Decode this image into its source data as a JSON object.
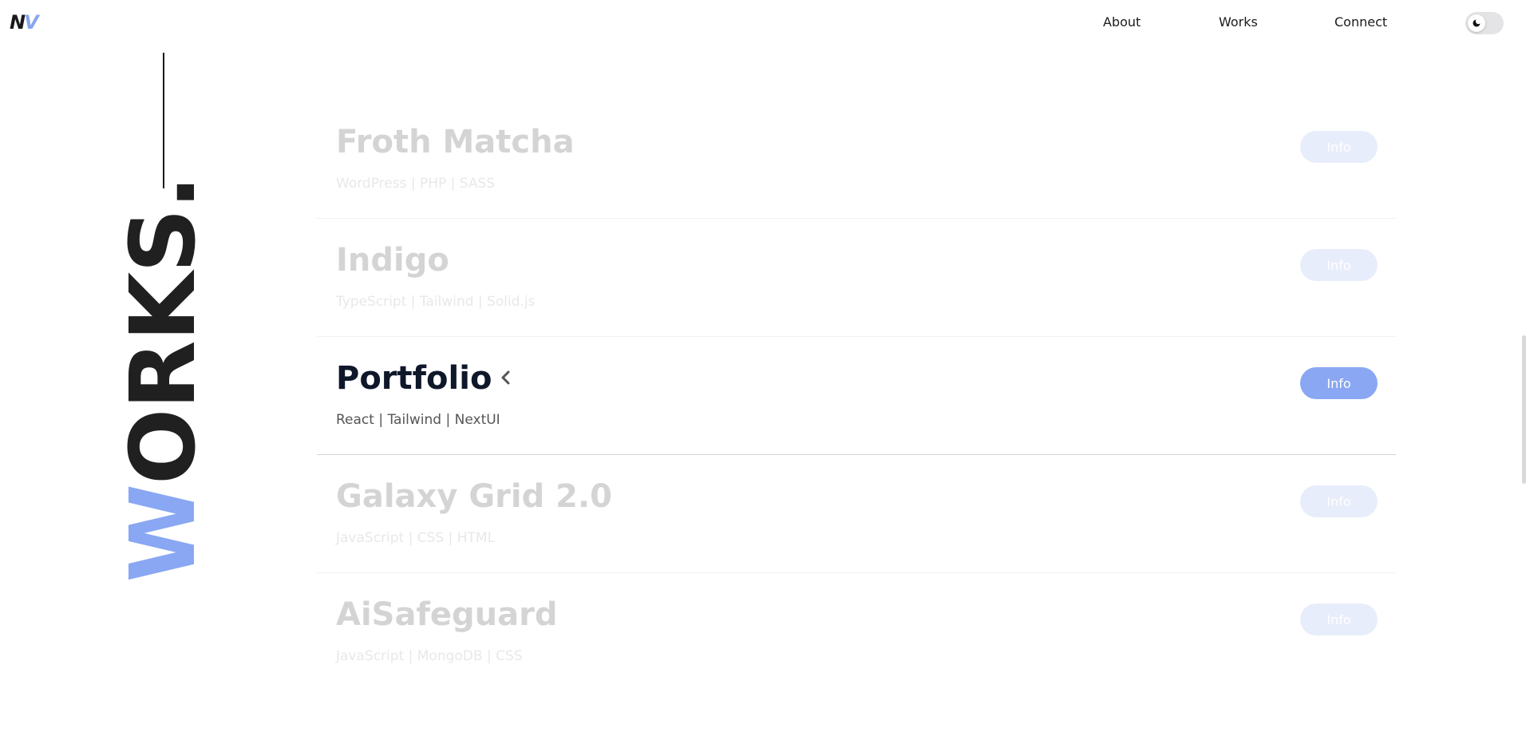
{
  "header": {
    "logo": {
      "letter1": "N",
      "letter2": "V"
    },
    "nav": [
      {
        "label": "About"
      },
      {
        "label": "Works"
      },
      {
        "label": "Connect"
      }
    ],
    "theme_toggle": {
      "icon": "moon-icon"
    }
  },
  "section": {
    "heading_w": "W",
    "heading_rest": "ORKS."
  },
  "projects": [
    {
      "title": "Froth Matcha",
      "tech": "WordPress | PHP | SASS",
      "button": "Info",
      "active": false
    },
    {
      "title": "Indigo",
      "tech": "TypeScript | Tailwind | Solid.js",
      "button": "Info",
      "active": false
    },
    {
      "title": "Portfolio",
      "tech": "React | Tailwind | NextUI",
      "button": "Info",
      "active": true
    },
    {
      "title": "Galaxy Grid 2.0",
      "tech": "JavaScript | CSS | HTML",
      "button": "Info",
      "active": false
    },
    {
      "title": "AiSafeguard",
      "tech": "JavaScript | MongoDB | CSS",
      "button": "Info",
      "active": false
    }
  ],
  "colors": {
    "accent": "#89a7f2",
    "dark": "#0f172a",
    "muted": "#d4d4d4"
  }
}
